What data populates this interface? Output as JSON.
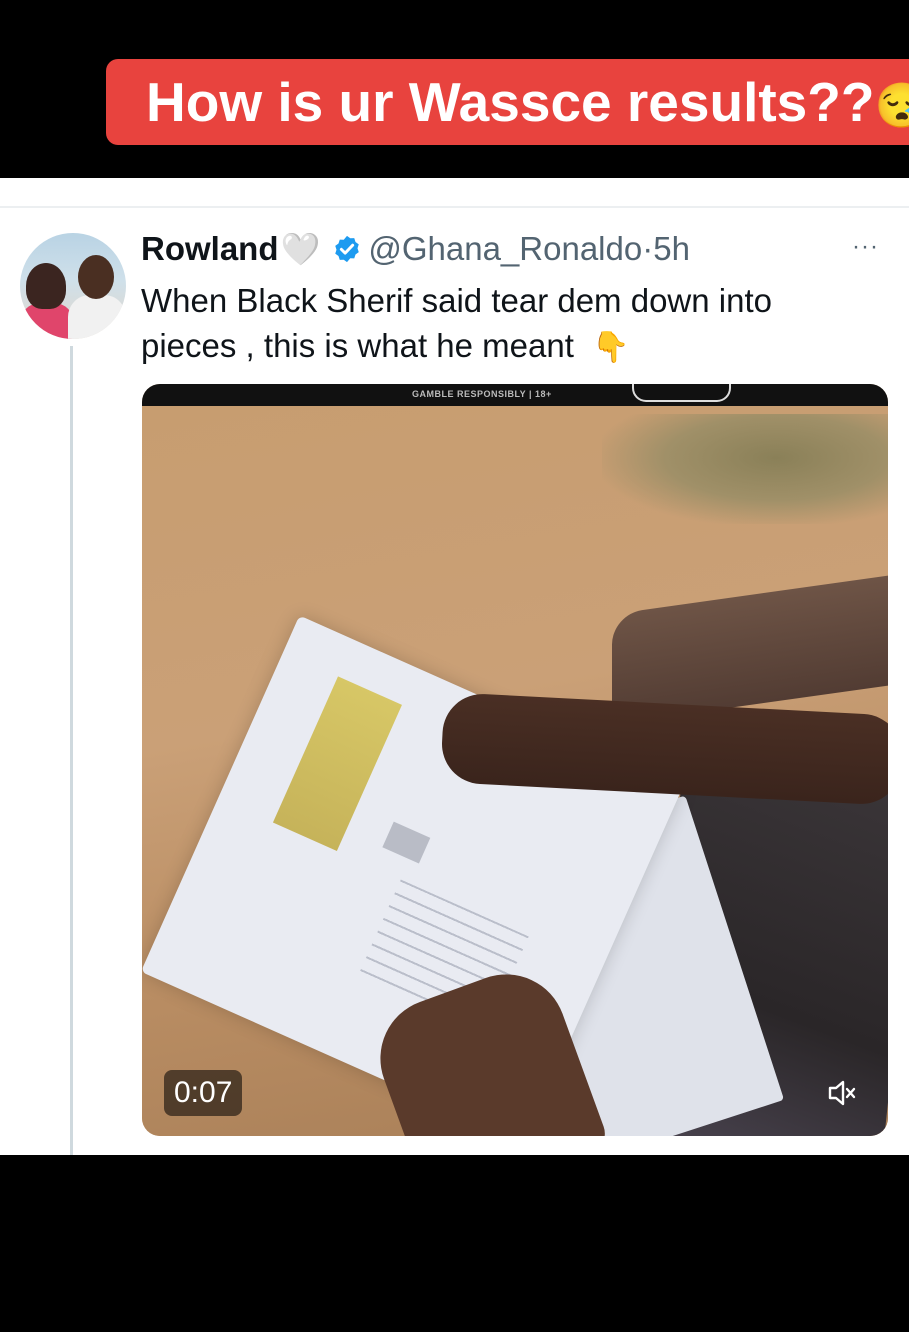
{
  "overlay": {
    "caption": "How is ur Wassce results??",
    "caption_emoji": "😪"
  },
  "tweet": {
    "display_name": "Rowland",
    "name_emoji": "🤍",
    "handle": "@Ghana_Ronaldo",
    "separator": "·",
    "time": "5h",
    "more_label": "···",
    "text_line1": "When Black Sherif said tear dem down into",
    "text_line2": "pieces , this is what he meant",
    "text_emoji": "👇",
    "video": {
      "duration": "0:07",
      "top_label": "GAMBLE RESPONSIBLY | 18+"
    }
  },
  "colors": {
    "caption_bg": "#e8433e",
    "verified_blue": "#1d9bf0",
    "secondary_text": "#536471"
  }
}
